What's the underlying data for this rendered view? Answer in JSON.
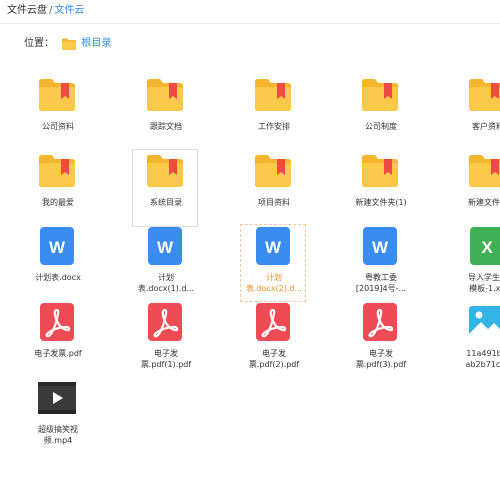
{
  "breadcrumb": {
    "root": "文件云盘",
    "separator": "/",
    "current": "文件云"
  },
  "location": {
    "label": "位置：",
    "path": "根目录"
  },
  "files": [
    {
      "name": "公司资料",
      "type": "folder"
    },
    {
      "name": "跟踪文档",
      "type": "folder"
    },
    {
      "name": "工作安排",
      "type": "folder"
    },
    {
      "name": "公司制度",
      "type": "folder"
    },
    {
      "name": "客户资料",
      "type": "folder"
    },
    {
      "name": "我的最爱",
      "type": "folder"
    },
    {
      "name": "系统目录",
      "type": "folder"
    },
    {
      "name": "项目资料",
      "type": "folder"
    },
    {
      "name": "新建文件夹(1)",
      "type": "folder"
    },
    {
      "name": "新建文件夹",
      "type": "folder"
    },
    {
      "name": "计划表.docx",
      "type": "word"
    },
    {
      "name": "计划\n表.docx(1).d...",
      "type": "word"
    },
    {
      "name": "计划\n表.docx(2).d...",
      "type": "word"
    },
    {
      "name": "粤教工委\n[2019]4号-...",
      "type": "word"
    },
    {
      "name": "导入学生成\n模板-1.xls",
      "type": "excel"
    },
    {
      "name": "电子发票.pdf",
      "type": "pdf"
    },
    {
      "name": "电子发\n票.pdf(1).pdf",
      "type": "pdf"
    },
    {
      "name": "电子发\n票.pdf(2).pdf",
      "type": "pdf"
    },
    {
      "name": "电子发\n票.pdf(3).pdf",
      "type": "pdf"
    },
    {
      "name": "11a491bf2\nab2b71c42",
      "type": "image"
    },
    {
      "name": "超级搞笑视\n频.mp4",
      "type": "video"
    }
  ],
  "colors": {
    "accent_blue": "#2d8cf0",
    "folder_yellow": "#f5b52e",
    "folder_bookmark": "#ef4a43",
    "word_blue": "#3b8cf0",
    "excel_green": "#3fb154",
    "pdf_red": "#ef4b55",
    "image_cyan": "#33b4e7",
    "video_dark": "#3a3a3a",
    "highlight_orange": "#f28c28"
  }
}
